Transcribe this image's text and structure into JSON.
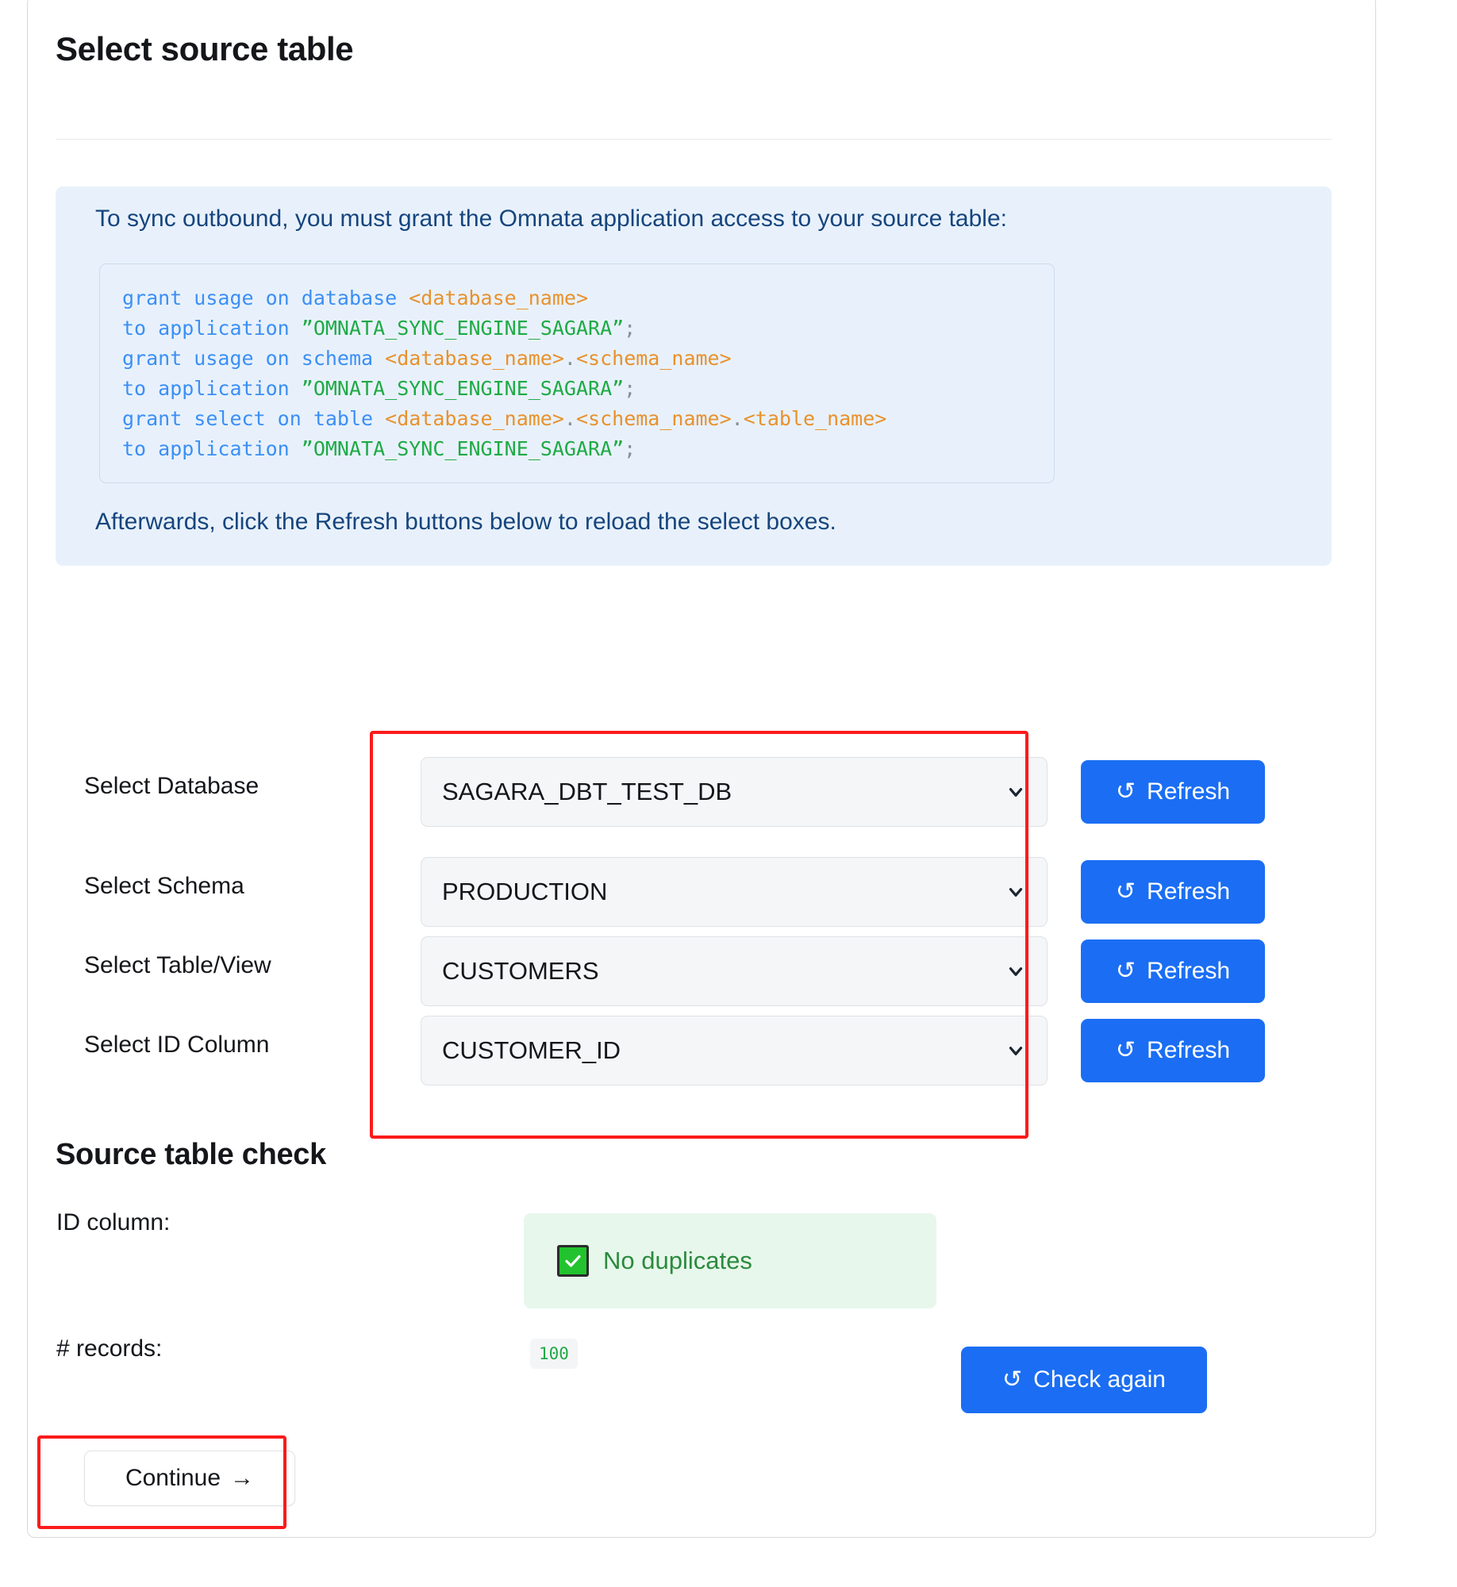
{
  "page": {
    "title": "Select source table",
    "section_title": "Source table check"
  },
  "info": {
    "intro": "To sync outbound, you must grant the Omnata application access to your source table:",
    "outro": "Afterwards, click the Refresh buttons below to reload the select boxes.",
    "code_lines": [
      [
        {
          "t": "grant usage on database ",
          "c": "kw"
        },
        {
          "t": "<database_name>",
          "c": "ph"
        }
      ],
      [
        {
          "t": "to application ",
          "c": "kw"
        },
        {
          "t": "”OMNATA_SYNC_ENGINE_SAGARA”",
          "c": "str"
        },
        {
          "t": ";",
          "c": "pn"
        }
      ],
      [
        {
          "t": "grant usage on schema ",
          "c": "kw"
        },
        {
          "t": "<database_name>",
          "c": "ph"
        },
        {
          "t": ".",
          "c": "pn"
        },
        {
          "t": "<schema_name>",
          "c": "ph"
        }
      ],
      [
        {
          "t": "to application ",
          "c": "kw"
        },
        {
          "t": "”OMNATA_SYNC_ENGINE_SAGARA”",
          "c": "str"
        },
        {
          "t": ";",
          "c": "pn"
        }
      ],
      [
        {
          "t": "grant select on table ",
          "c": "kw"
        },
        {
          "t": "<database_name>",
          "c": "ph"
        },
        {
          "t": ".",
          "c": "pn"
        },
        {
          "t": "<schema_name>",
          "c": "ph"
        },
        {
          "t": ".",
          "c": "pn"
        },
        {
          "t": "<table_name>",
          "c": "ph"
        }
      ],
      [
        {
          "t": "to application ",
          "c": "kw"
        },
        {
          "t": "”OMNATA_SYNC_ENGINE_SAGARA”",
          "c": "str"
        },
        {
          "t": ";",
          "c": "pn"
        }
      ]
    ]
  },
  "form": {
    "rows": [
      {
        "label": "Select Database",
        "value": "SAGARA_DBT_TEST_DB",
        "button": "Refresh"
      },
      {
        "label": "Select Schema",
        "value": "PRODUCTION",
        "button": "Refresh"
      },
      {
        "label": "Select Table/View",
        "value": "CUSTOMERS",
        "button": "Refresh"
      },
      {
        "label": "Select ID Column",
        "value": "CUSTOMER_ID",
        "button": "Refresh"
      }
    ]
  },
  "check": {
    "id_column_label": "ID column:",
    "id_column_status": "No duplicates",
    "records_label": "# records:",
    "records_value": "100",
    "check_again_button": "Check again"
  },
  "footer": {
    "continue_label": "Continue",
    "continue_arrow": "→"
  },
  "icons": {
    "refresh_glyph": "↺"
  },
  "colors": {
    "accent_blue": "#1b6ef3",
    "info_bg": "#e8f1fb",
    "info_text": "#16457e",
    "success_bg": "#e7f7ec",
    "success_text": "#2c8a3d",
    "annotation_red": "#fb1b1b"
  }
}
